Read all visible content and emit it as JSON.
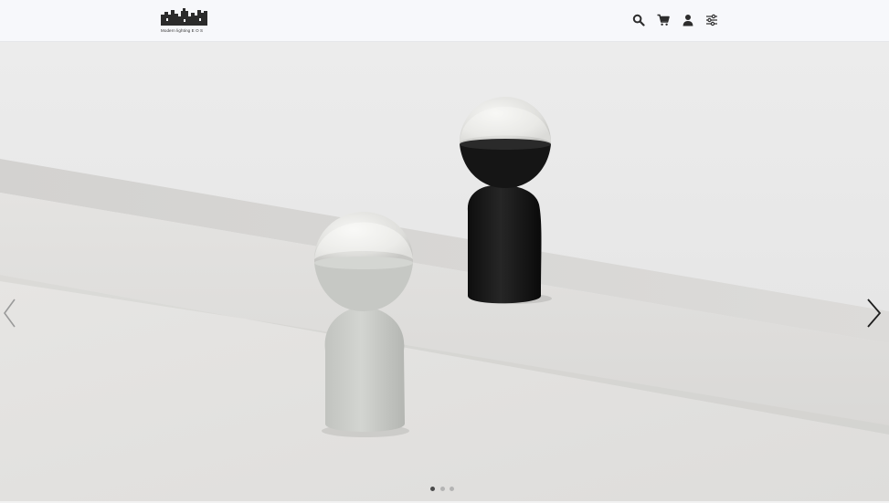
{
  "header": {
    "logo": {
      "caption": "Modern lighting  E O S",
      "icon": "building-skyline-logo"
    },
    "icons": [
      {
        "name": "search-icon"
      },
      {
        "name": "cart-icon"
      },
      {
        "name": "user-icon"
      },
      {
        "name": "filter-sliders-icon"
      }
    ]
  },
  "hero": {
    "prev_arrow": "chevron-left-icon",
    "next_arrow": "chevron-right-icon",
    "slide_count": 3,
    "active_slide": 1
  },
  "colors": {
    "header_bg": "#f7f8fb",
    "lamp_dark": "#1a1a1a",
    "lamp_light": "#cfd1cd",
    "dot_active": "#4a4a4a",
    "dot_inactive": "#b4b4b4"
  }
}
